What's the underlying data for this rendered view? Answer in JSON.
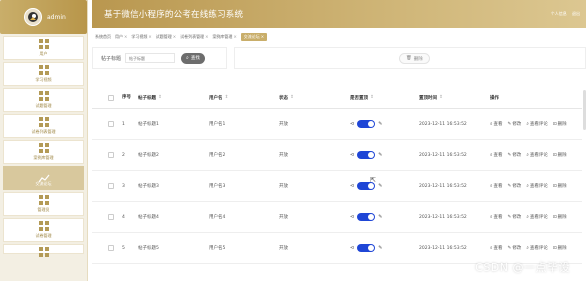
{
  "sidebar": {
    "username": "admin",
    "items": [
      {
        "label": "用户"
      },
      {
        "label": "学习视频"
      },
      {
        "label": "试题管理"
      },
      {
        "label": "试卷列表管理"
      },
      {
        "label": "案例库管理"
      },
      {
        "label": "交流论坛",
        "active": true
      },
      {
        "label": "管理员"
      },
      {
        "label": "试卷管理"
      },
      {
        "label": ""
      }
    ]
  },
  "header": {
    "title": "基于微信小程序的公考在线练习系统",
    "user_center": "个人信息",
    "logout": "退出"
  },
  "tabs": [
    {
      "label": "系统首页",
      "closable": false
    },
    {
      "label": "用户",
      "closable": true
    },
    {
      "label": "学习视频",
      "closable": true
    },
    {
      "label": "试题管理",
      "closable": true
    },
    {
      "label": "试卷列表管理",
      "closable": true
    },
    {
      "label": "案例库管理",
      "closable": true
    },
    {
      "label": "交流论坛",
      "closable": true,
      "active": true
    }
  ],
  "search": {
    "label": "帖子标题",
    "placeholder": "帖子标题",
    "button": "查找"
  },
  "actions": {
    "delete": "删除"
  },
  "table": {
    "headers": {
      "no": "序号",
      "title": "帖子标题",
      "user": "用户名",
      "status": "状态",
      "top": "是否置顶",
      "time": "置顶时间",
      "ops": "操作"
    },
    "rows": [
      {
        "no": "1",
        "title": "帖子标题1",
        "user": "用户名1",
        "status": "开放",
        "time": "2023-12-11 16:53:52"
      },
      {
        "no": "2",
        "title": "帖子标题2",
        "user": "用户名2",
        "status": "开放",
        "time": "2023-12-11 16:53:52"
      },
      {
        "no": "3",
        "title": "帖子标题3",
        "user": "用户名3",
        "status": "开放",
        "time": "2023-12-11 16:53:52"
      },
      {
        "no": "4",
        "title": "帖子标题4",
        "user": "用户名4",
        "status": "开放",
        "time": "2023-12-11 16:53:52"
      },
      {
        "no": "5",
        "title": "帖子标题5",
        "user": "用户名5",
        "status": "开放",
        "time": "2023-12-11 16:53:52"
      }
    ],
    "row_actions": {
      "view": "查看",
      "edit": "修改",
      "comments": "查看评论",
      "delete": "删除"
    }
  },
  "watermark": "CSDN @一点毕设",
  "colors": {
    "accent": "#c9ae6a",
    "toggle_on": "#1f46d6",
    "search_button": "#6d6d6d"
  }
}
